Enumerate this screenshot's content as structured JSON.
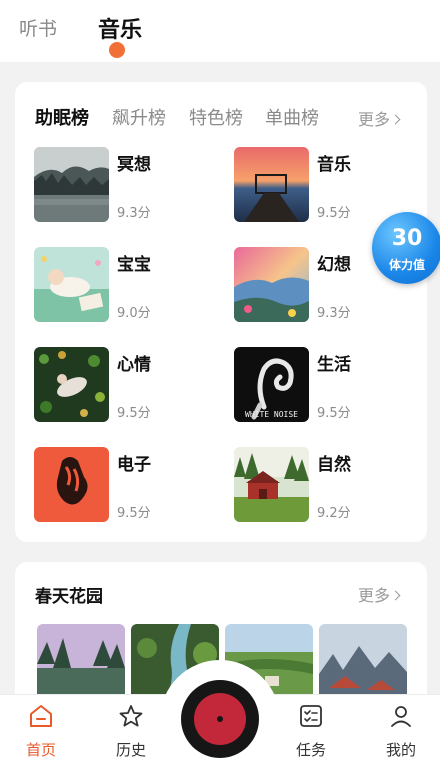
{
  "top_tabs": [
    {
      "label": "听书",
      "active": false
    },
    {
      "label": "音乐",
      "active": true
    }
  ],
  "ranking": {
    "tabs": [
      {
        "label": "助眠榜",
        "active": true
      },
      {
        "label": "飙升榜",
        "active": false
      },
      {
        "label": "特色榜",
        "active": false
      },
      {
        "label": "单曲榜",
        "active": false
      }
    ],
    "more_label": "更多",
    "items": [
      {
        "name": "冥想",
        "score": "9.3分"
      },
      {
        "name": "音乐",
        "score": "9.5分"
      },
      {
        "name": "宝宝",
        "score": "9.0分"
      },
      {
        "name": "幻想",
        "score": "9.3分"
      },
      {
        "name": "心情",
        "score": "9.5分"
      },
      {
        "name": "生活",
        "score": "9.5分",
        "thumb_text": "WHITE NOISE"
      },
      {
        "name": "电子",
        "score": "9.5分"
      },
      {
        "name": "自然",
        "score": "9.2分"
      }
    ]
  },
  "energy_badge": {
    "value": "30",
    "label": "体力值"
  },
  "spring_section": {
    "title": "春天花园",
    "more_label": "更多"
  },
  "bottom_nav": {
    "items": [
      {
        "label": "首页",
        "icon": "home-icon",
        "active": true
      },
      {
        "label": "历史",
        "icon": "star-icon",
        "active": false
      },
      {
        "label": "任务",
        "icon": "task-list-icon",
        "active": false
      },
      {
        "label": "我的",
        "icon": "person-icon",
        "active": false
      }
    ],
    "player_icon": "record-disc-icon"
  },
  "colors": {
    "accent": "#f07038",
    "nav_active": "#e85a2a",
    "badge_blue": "#1a86e8",
    "disc_red": "#c2283a"
  }
}
